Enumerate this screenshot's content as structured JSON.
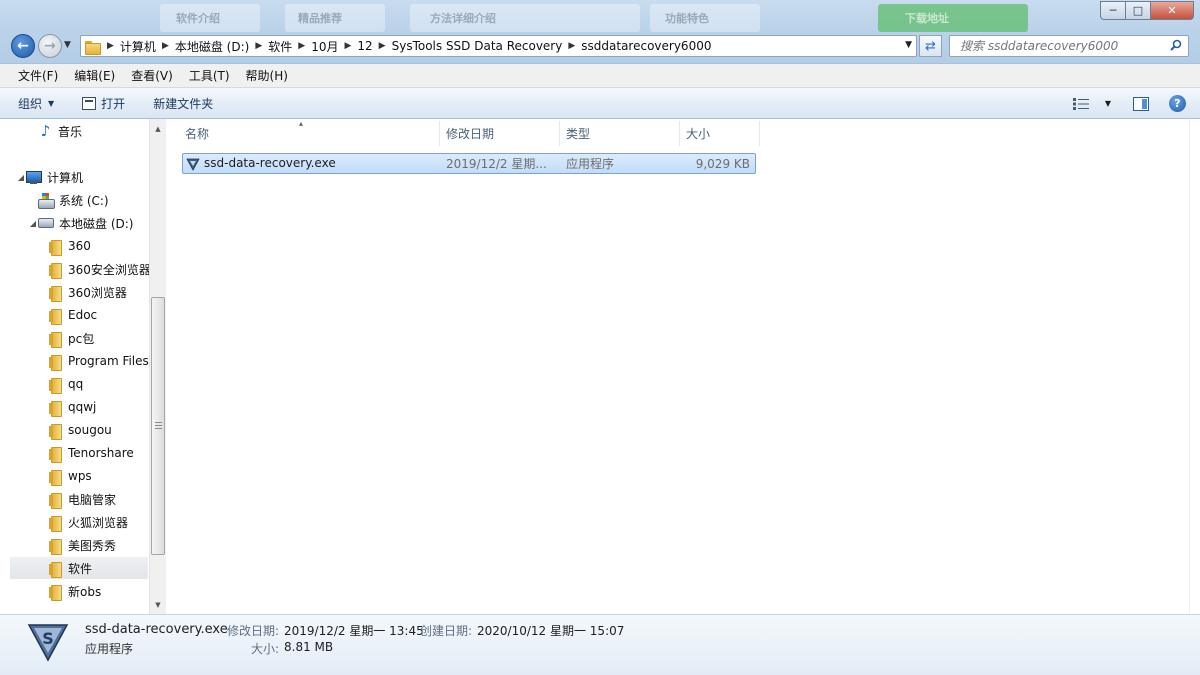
{
  "window": {
    "background_tabs": [
      "软件介绍",
      "精品推荐",
      "方法详细介绍",
      "功能特色",
      "下载地址"
    ],
    "controls": {
      "minimize": "─",
      "maximize": "□",
      "close": "✕"
    }
  },
  "address_bar": {
    "crumbs": [
      "计算机",
      "本地磁盘 (D:)",
      "软件",
      "10月",
      "12",
      "SysTools SSD Data Recovery",
      "ssddatarecovery6000"
    ]
  },
  "search": {
    "placeholder": "搜索 ssddatarecovery6000"
  },
  "menu": [
    "文件(F)",
    "编辑(E)",
    "查看(V)",
    "工具(T)",
    "帮助(H)"
  ],
  "toolbar": {
    "organize": "组织",
    "open": "打开",
    "new_folder": "新建文件夹"
  },
  "nav": {
    "music": "音乐",
    "computer": "计算机",
    "drive_c": "系统 (C:)",
    "drive_d": "本地磁盘 (D:)",
    "folders": [
      "360",
      "360安全浏览器",
      "360浏览器",
      "Edoc",
      "pc包",
      "Program Files",
      "qq",
      "qqwj",
      "sougou",
      "Tenorshare",
      "wps",
      "电脑管家",
      "火狐浏览器",
      "美图秀秀",
      "软件",
      "新obs"
    ],
    "selected_folder": "软件"
  },
  "columns": {
    "name": "名称",
    "modified": "修改日期",
    "type": "类型",
    "size": "大小"
  },
  "files": [
    {
      "name": "ssd-data-recovery.exe",
      "modified": "2019/12/2 星期...",
      "type": "应用程序",
      "size": "9,029 KB"
    }
  ],
  "details": {
    "name": "ssd-data-recovery.exe",
    "type": "应用程序",
    "modified_label": "修改日期:",
    "modified_value": "2019/12/2 星期一 13:45",
    "created_label": "创建日期:",
    "created_value": "2020/10/12 星期一 15:07",
    "size_label": "大小:",
    "size_value": "8.81 MB"
  },
  "colors": {
    "accent": "#1f5aa8",
    "selection": "#c1dcfb",
    "toolbar": "#dfe9f5"
  }
}
